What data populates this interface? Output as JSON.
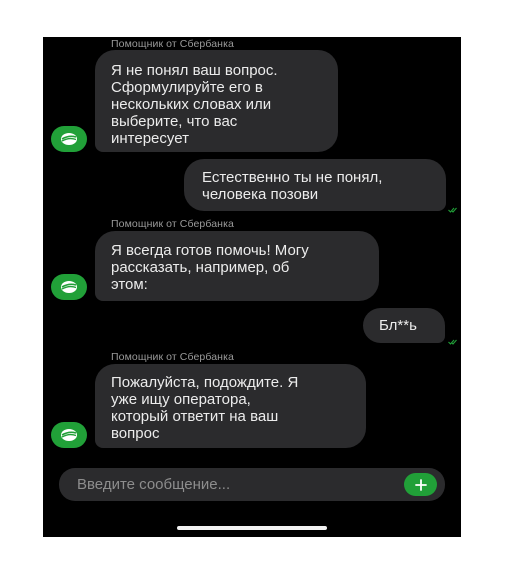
{
  "chat": {
    "sender_name": "Помощник от Сбербанка",
    "messages": [
      {
        "from": "bot",
        "text": "Я не понял ваш вопрос.\nСформулируйте его в\nнескольких словах или\nвыберите, что вас\nинтересует"
      },
      {
        "from": "user",
        "text": "Естественно ты не понял,\nчеловека позови",
        "status": "read"
      },
      {
        "from": "bot",
        "text": "Я всегда готов помочь! Могу\nрассказать, например, об\nэтом:"
      },
      {
        "from": "user",
        "text": "Бл**ь",
        "status": "read"
      },
      {
        "from": "bot",
        "text": "Пожалуйста, подождите. Я\nуже ищу оператора,\nкоторый ответит на ваш\nвопрос"
      }
    ]
  },
  "input": {
    "placeholder": "Введите сообщение..."
  },
  "icons": {
    "avatar": "sber-logo-icon",
    "send": "plus-icon",
    "read_status": "double-check-icon"
  },
  "colors": {
    "background": "#000000",
    "bubble": "#2b2b2d",
    "accent": "#21a038",
    "text": "#ececec",
    "sender": "#9a9a9a"
  }
}
